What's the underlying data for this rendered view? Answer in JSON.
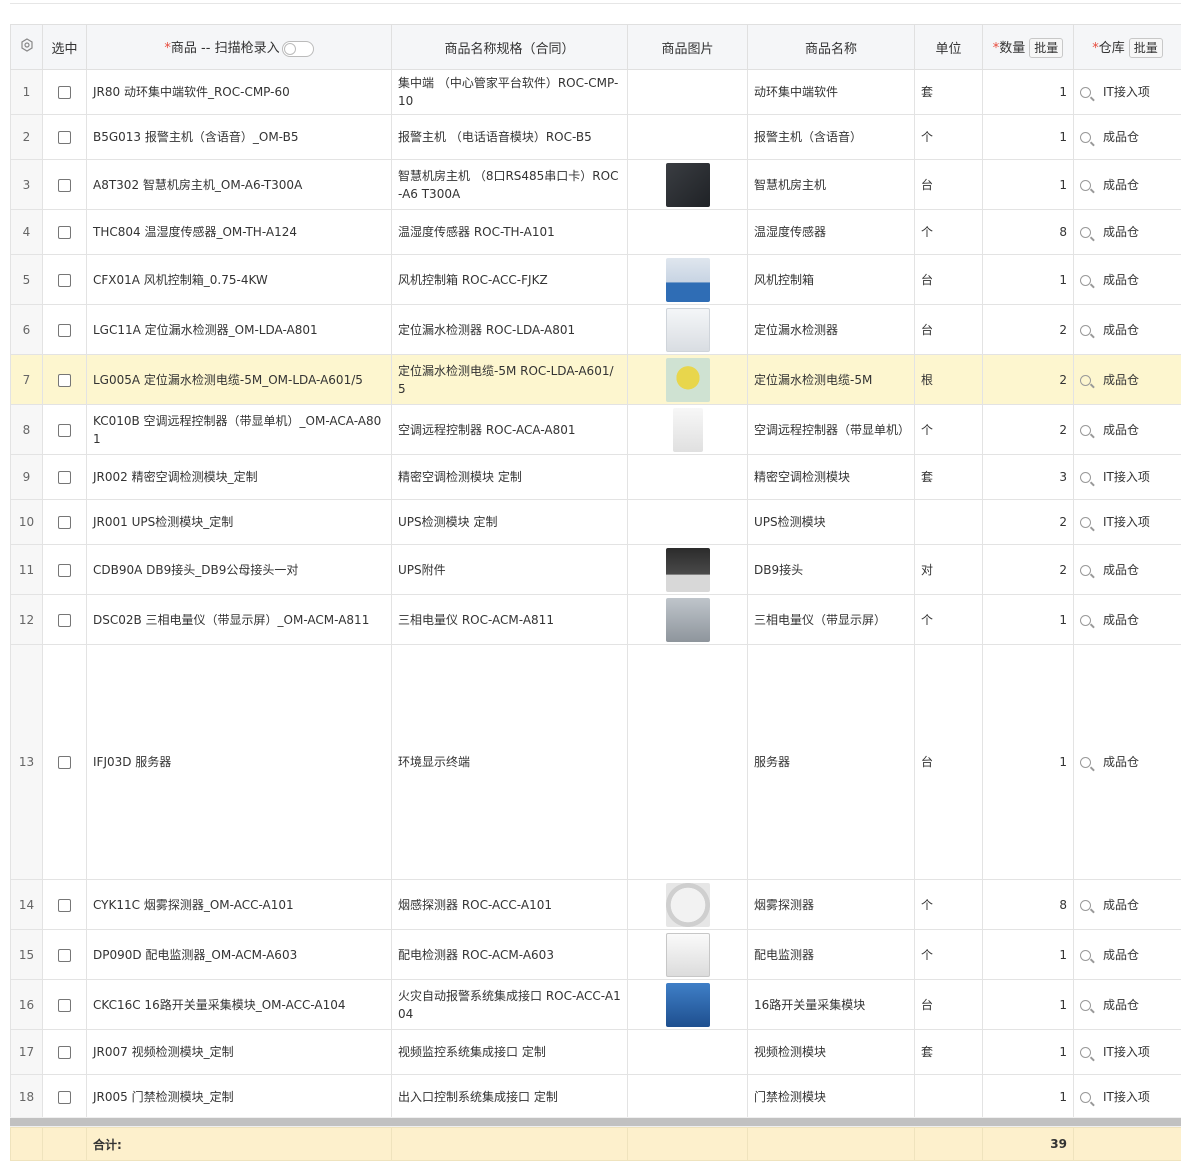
{
  "header": {
    "select": "选中",
    "product_required_mark": "*",
    "product": "商品 -- 扫描枪录入",
    "spec": "商品名称规格（合同）",
    "image": "商品图片",
    "name": "商品名称",
    "unit": "单位",
    "qty_required_mark": "*",
    "qty": "数量",
    "qty_batch": "批量",
    "wh_required_mark": "*",
    "warehouse": "仓库",
    "wh_batch": "批量"
  },
  "rows": [
    {
      "idx": "1",
      "product": "JR80 动环集中端软件_ROC-CMP-60",
      "spec": "集中端 （中心管家平台软件）ROC-CMP-10",
      "image": "",
      "name": "动环集中端软件",
      "unit": "套",
      "qty": "1",
      "warehouse": "IT接入项"
    },
    {
      "idx": "2",
      "product": "B5G013 报警主机（含语音）_OM-B5",
      "spec": "报警主机 （电话语音模块）ROC-B5",
      "image": "",
      "name": "报警主机（含语音）",
      "unit": "个",
      "qty": "1",
      "warehouse": "成品仓"
    },
    {
      "idx": "3",
      "product": "A8T302 智慧机房主机_OM-A6-T300A",
      "spec": "智慧机房主机 （8口RS485串口卡）ROC-A6 T300A",
      "image": "dark",
      "name": "智慧机房主机",
      "unit": "台",
      "qty": "1",
      "warehouse": "成品仓"
    },
    {
      "idx": "4",
      "product": "THC804 温湿度传感器_OM-TH-A124",
      "spec": "温湿度传感器 ROC-TH-A101",
      "image": "",
      "name": "温湿度传感器",
      "unit": "个",
      "qty": "8",
      "warehouse": "成品仓"
    },
    {
      "idx": "5",
      "product": "CFX01A 风机控制箱_0.75-4KW",
      "spec": "风机控制箱 ROC-ACC-FJKZ",
      "image": "panel",
      "name": "风机控制箱",
      "unit": "台",
      "qty": "1",
      "warehouse": "成品仓"
    },
    {
      "idx": "6",
      "product": "LGC11A 定位漏水检测器_OM-LDA-A801",
      "spec": "定位漏水检测器 ROC-LDA-A801",
      "image": "white",
      "name": "定位漏水检测器",
      "unit": "台",
      "qty": "2",
      "warehouse": "成品仓"
    },
    {
      "idx": "7",
      "product": "LG005A 定位漏水检测电缆-5M_OM-LDA-A601/5",
      "spec": "定位漏水检测电缆-5M ROC-LDA-A601/5",
      "image": "yellow",
      "name": "定位漏水检测电缆-5M",
      "unit": "根",
      "qty": "2",
      "warehouse": "成品仓",
      "highlight": true
    },
    {
      "idx": "8",
      "product": "KC010B 空调远程控制器（带显单机）_OM-ACA-A801",
      "spec": "空调远程控制器 ROC-ACA-A801",
      "image": "small",
      "name": "空调远程控制器（带显单机）",
      "unit": "个",
      "qty": "2",
      "warehouse": "成品仓"
    },
    {
      "idx": "9",
      "product": "JR002 精密空调检测模块_定制",
      "spec": "精密空调检测模块 定制",
      "image": "",
      "name": "精密空调检测模块",
      "unit": "套",
      "qty": "3",
      "warehouse": "IT接入项"
    },
    {
      "idx": "10",
      "product": "JR001 UPS检测模块_定制",
      "spec": "UPS检测模块 定制",
      "image": "",
      "name": "UPS检测模块",
      "unit": "",
      "qty": "2",
      "warehouse": "IT接入项"
    },
    {
      "idx": "11",
      "product": "CDB90A DB9接头_DB9公母接头一对",
      "spec": "UPS附件",
      "image": "db9",
      "name": "DB9接头",
      "unit": "对",
      "qty": "2",
      "warehouse": "成品仓"
    },
    {
      "idx": "12",
      "product": "DSC02B 三相电量仪（带显示屏）_OM-ACM-A811",
      "spec": "三相电量仪 ROC-ACM-A811",
      "image": "meter",
      "name": "三相电量仪（带显示屏）",
      "unit": "个",
      "qty": "1",
      "warehouse": "成品仓"
    },
    {
      "idx": "13",
      "product": "IFJ03D 服务器",
      "spec": "环境显示终端",
      "image": "",
      "name": "服务器",
      "unit": "台",
      "qty": "1",
      "warehouse": "成品仓",
      "tall": true
    },
    {
      "idx": "14",
      "product": "CYK11C 烟雾探测器_OM-ACC-A101",
      "spec": "烟感探测器 ROC-ACC-A101",
      "image": "smoke",
      "name": "烟雾探测器",
      "unit": "个",
      "qty": "8",
      "warehouse": "成品仓"
    },
    {
      "idx": "15",
      "product": "DP090D 配电监测器_OM-ACM-A603",
      "spec": "配电检测器 ROC-ACM-A603",
      "image": "module",
      "name": "配电监测器",
      "unit": "个",
      "qty": "1",
      "warehouse": "成品仓"
    },
    {
      "idx": "16",
      "product": "CKC16C 16路开关量采集模块_OM-ACC-A104",
      "spec": "火灾自动报警系统集成接口 ROC-ACC-A104",
      "image": "blue",
      "name": "16路开关量采集模块",
      "unit": "台",
      "qty": "1",
      "warehouse": "成品仓"
    },
    {
      "idx": "17",
      "product": "JR007 视频检测模块_定制",
      "spec": "视频监控系统集成接口 定制",
      "image": "",
      "name": "视频检测模块",
      "unit": "套",
      "qty": "1",
      "warehouse": "IT接入项"
    },
    {
      "idx": "18",
      "product": "JR005 门禁检测模块_定制",
      "spec": "出入口控制系统集成接口 定制",
      "image": "",
      "name": "门禁检测模块",
      "unit": "",
      "qty": "1",
      "warehouse": "IT接入项"
    }
  ],
  "footer": {
    "total_label": "合计:",
    "total_qty": "39"
  }
}
